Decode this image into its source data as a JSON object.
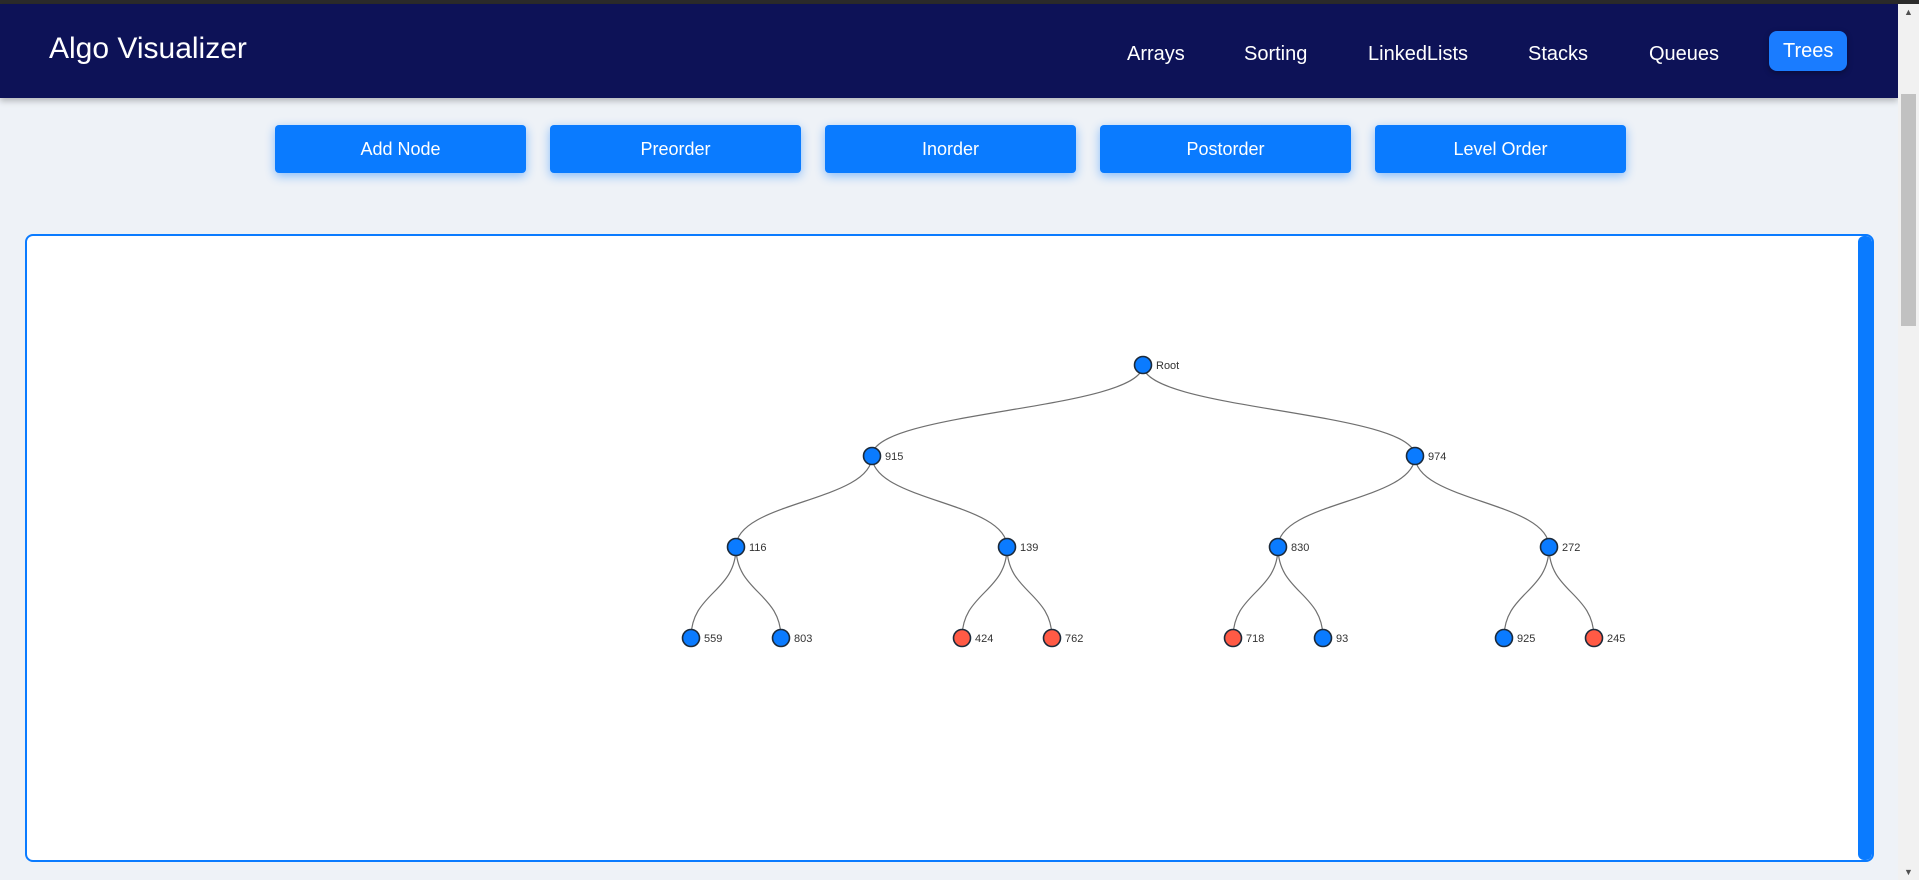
{
  "app": {
    "title": "Algo Visualizer"
  },
  "nav": {
    "items": [
      {
        "label": "Arrays",
        "active": false
      },
      {
        "label": "Sorting",
        "active": false
      },
      {
        "label": "LinkedLists",
        "active": false
      },
      {
        "label": "Stacks",
        "active": false
      },
      {
        "label": "Queues",
        "active": false
      },
      {
        "label": "Trees",
        "active": true
      }
    ]
  },
  "controls": {
    "buttons": [
      {
        "label": "Add Node"
      },
      {
        "label": "Preorder"
      },
      {
        "label": "Inorder"
      },
      {
        "label": "Postorder"
      },
      {
        "label": "Level Order"
      }
    ]
  },
  "colors": {
    "nav_background": "#0d1257",
    "accent": "#0a7bff",
    "node_default": "#0a7bff",
    "node_highlight": "#ff5a45"
  },
  "tree": {
    "nodes": [
      {
        "id": "root",
        "label": "Root",
        "color": "#0a7bff"
      },
      {
        "id": "n915",
        "label": "915",
        "color": "#0a7bff"
      },
      {
        "id": "n974",
        "label": "974",
        "color": "#0a7bff"
      },
      {
        "id": "n116",
        "label": "116",
        "color": "#0a7bff"
      },
      {
        "id": "n139",
        "label": "139",
        "color": "#0a7bff"
      },
      {
        "id": "n830",
        "label": "830",
        "color": "#0a7bff"
      },
      {
        "id": "n272",
        "label": "272",
        "color": "#0a7bff"
      },
      {
        "id": "n559",
        "label": "559",
        "color": "#0a7bff"
      },
      {
        "id": "n803",
        "label": "803",
        "color": "#0a7bff"
      },
      {
        "id": "n424",
        "label": "424",
        "color": "#ff5a45"
      },
      {
        "id": "n762",
        "label": "762",
        "color": "#ff5a45"
      },
      {
        "id": "n718",
        "label": "718",
        "color": "#ff5a45"
      },
      {
        "id": "n93",
        "label": "93",
        "color": "#0a7bff"
      },
      {
        "id": "n925",
        "label": "925",
        "color": "#0a7bff"
      },
      {
        "id": "n245",
        "label": "245",
        "color": "#ff5a45"
      }
    ],
    "edges": [
      [
        "root",
        "n915"
      ],
      [
        "root",
        "n974"
      ],
      [
        "n915",
        "n116"
      ],
      [
        "n915",
        "n139"
      ],
      [
        "n974",
        "n830"
      ],
      [
        "n974",
        "n272"
      ],
      [
        "n116",
        "n559"
      ],
      [
        "n116",
        "n803"
      ],
      [
        "n139",
        "n424"
      ],
      [
        "n139",
        "n762"
      ],
      [
        "n830",
        "n718"
      ],
      [
        "n830",
        "n93"
      ],
      [
        "n272",
        "n925"
      ],
      [
        "n272",
        "n245"
      ]
    ]
  }
}
